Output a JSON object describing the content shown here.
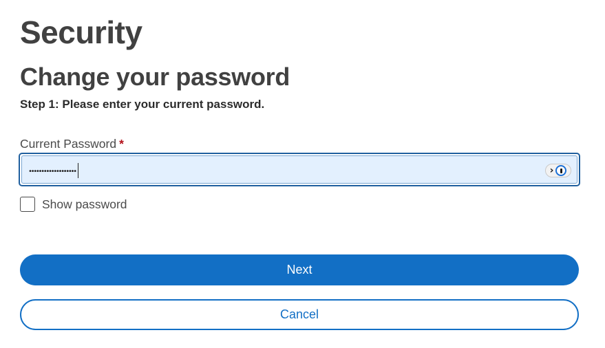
{
  "page": {
    "title": "Security"
  },
  "section": {
    "title": "Change your password",
    "step_text": "Step 1: Please enter your current password."
  },
  "form": {
    "password_field": {
      "label": "Current Password",
      "required_marker": "*",
      "masked_value": "•••••••••••••••••••",
      "password_manager_icon": "1password-icon",
      "expand_icon": "chevron-right-icon"
    },
    "show_password": {
      "label": "Show password",
      "checked": false
    }
  },
  "actions": {
    "next_label": "Next",
    "cancel_label": "Cancel"
  },
  "colors": {
    "primary": "#126fc5",
    "field_fill": "#e3f0fe",
    "required": "#b3111a",
    "heading": "#414141"
  }
}
